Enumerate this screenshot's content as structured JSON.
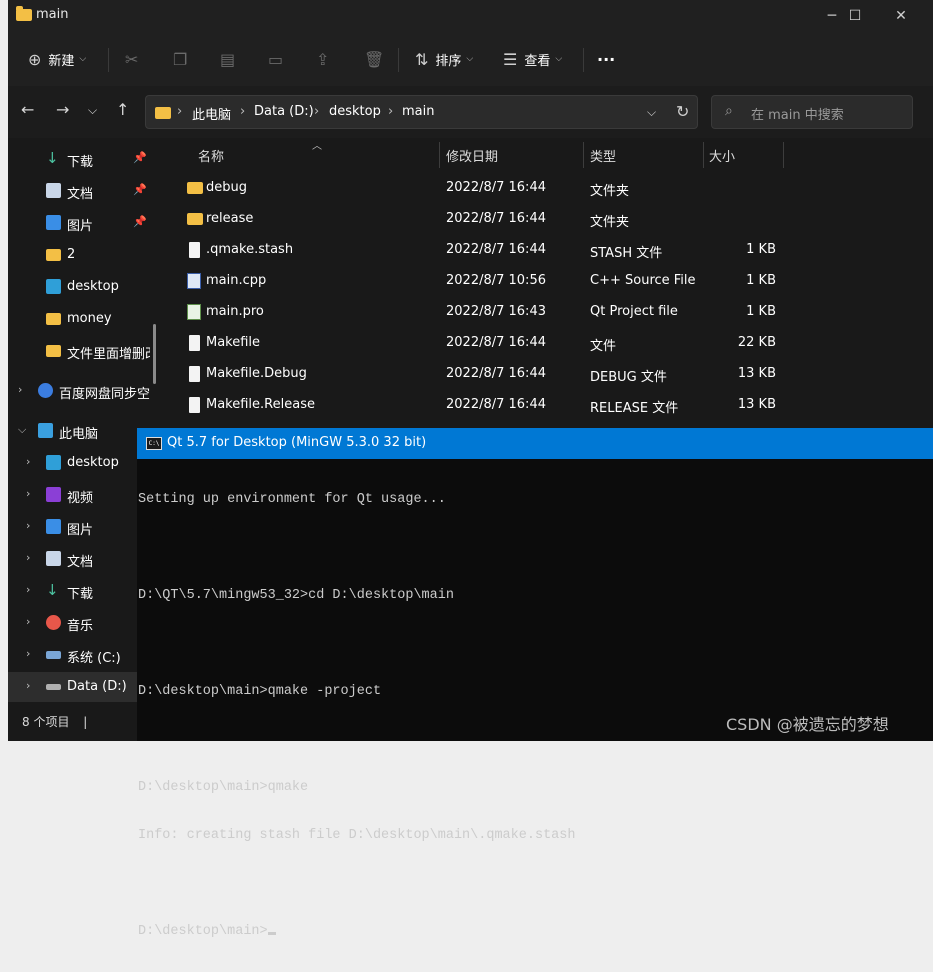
{
  "window": {
    "title": "main",
    "controls": {
      "minimize": "─",
      "maximize": "☐",
      "close": "✕"
    }
  },
  "toolbar": {
    "new_label": "新建",
    "sort_label": "排序",
    "view_label": "查看",
    "more_label": "···"
  },
  "navigation": {
    "breadcrumb": [
      "此电脑",
      "Data (D:)",
      "desktop",
      "main"
    ],
    "separator": "›",
    "search_placeholder": "在 main 中搜索"
  },
  "sidebar": {
    "quick_access": [
      {
        "label": "下载",
        "icon": "download-icon",
        "pinned": true
      },
      {
        "label": "文档",
        "icon": "document-icon",
        "pinned": true
      },
      {
        "label": "图片",
        "icon": "picture-icon",
        "pinned": true
      },
      {
        "label": "2",
        "icon": "folder-icon",
        "pinned": false
      },
      {
        "label": "desktop",
        "icon": "desktop-icon",
        "pinned": false
      },
      {
        "label": "money",
        "icon": "folder-icon",
        "pinned": false
      },
      {
        "label": "文件里面增删改",
        "icon": "folder-icon",
        "pinned": false
      }
    ],
    "cloud": {
      "label": "百度网盘同步空间",
      "icon": "cloud-icon"
    },
    "this_pc": {
      "label": "此电脑",
      "children": [
        {
          "label": "desktop",
          "icon": "desktop-icon"
        },
        {
          "label": "视频",
          "icon": "video-icon"
        },
        {
          "label": "图片",
          "icon": "picture-icon"
        },
        {
          "label": "文档",
          "icon": "document-icon"
        },
        {
          "label": "下载",
          "icon": "download-icon"
        },
        {
          "label": "音乐",
          "icon": "music-icon"
        },
        {
          "label": "系统 (C:)",
          "icon": "drive-icon"
        },
        {
          "label": "Data (D:)",
          "icon": "drive-icon"
        }
      ]
    }
  },
  "file_list": {
    "columns": [
      "名称",
      "修改日期",
      "类型",
      "大小"
    ],
    "rows": [
      {
        "name": "debug",
        "date": "2022/8/7 16:44",
        "type": "文件夹",
        "size": "",
        "icon": "folder"
      },
      {
        "name": "release",
        "date": "2022/8/7 16:44",
        "type": "文件夹",
        "size": "",
        "icon": "folder"
      },
      {
        "name": ".qmake.stash",
        "date": "2022/8/7 16:44",
        "type": "STASH 文件",
        "size": "1 KB",
        "icon": "file"
      },
      {
        "name": "main.cpp",
        "date": "2022/8/7 10:56",
        "type": "C++ Source File",
        "size": "1 KB",
        "icon": "cpp"
      },
      {
        "name": "main.pro",
        "date": "2022/8/7 16:43",
        "type": "Qt Project file",
        "size": "1 KB",
        "icon": "pro"
      },
      {
        "name": "Makefile",
        "date": "2022/8/7 16:44",
        "type": "文件",
        "size": "22 KB",
        "icon": "file"
      },
      {
        "name": "Makefile.Debug",
        "date": "2022/8/7 16:44",
        "type": "DEBUG 文件",
        "size": "13 KB",
        "icon": "file"
      },
      {
        "name": "Makefile.Release",
        "date": "2022/8/7 16:44",
        "type": "RELEASE 文件",
        "size": "13 KB",
        "icon": "file"
      }
    ]
  },
  "status_bar": {
    "item_count": "8 个项目",
    "divider": "|"
  },
  "console": {
    "title": "Qt 5.7 for Desktop (MinGW 5.3.0 32 bit)",
    "icon_text": "C:\\",
    "lines": [
      "Setting up environment for Qt usage...",
      "",
      "D:\\QT\\5.7\\mingw53_32>cd D:\\desktop\\main",
      "",
      "D:\\desktop\\main>qmake -project",
      "",
      "D:\\desktop\\main>qmake",
      "Info: creating stash file D:\\desktop\\main\\.qmake.stash",
      "",
      "D:\\desktop\\main>"
    ]
  },
  "watermark": "CSDN @被遗忘的梦想",
  "colors": {
    "window_bg": "#191919",
    "folder": "#f3bf45",
    "console_title_bg": "#0078d4",
    "console_bg": "#0c0c0c",
    "console_text": "#cccccc"
  }
}
